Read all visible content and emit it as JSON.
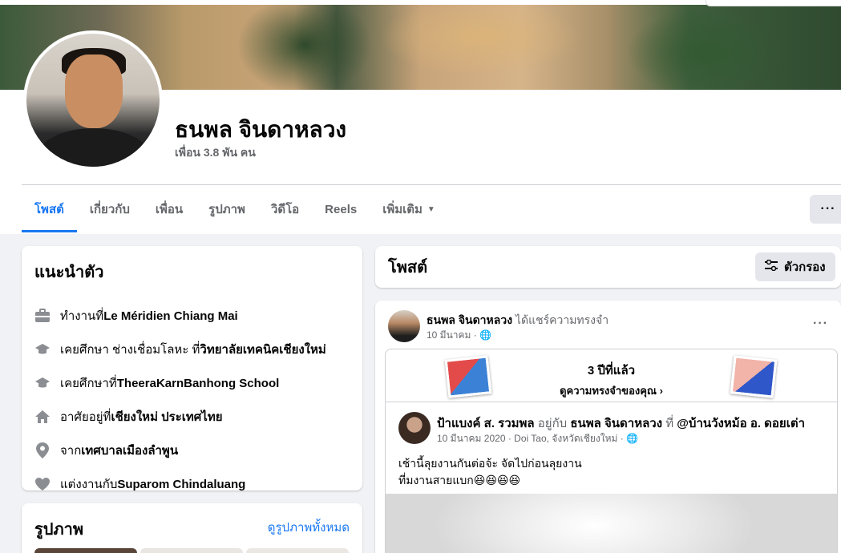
{
  "profile": {
    "name": "ธนพล จินดาหลวง",
    "friends": "เพื่อน 3.8 พัน คน"
  },
  "tabs": [
    {
      "label": "โพสต์"
    },
    {
      "label": "เกี่ยวกับ"
    },
    {
      "label": "เพื่อน"
    },
    {
      "label": "รูปภาพ"
    },
    {
      "label": "วิดีโอ"
    },
    {
      "label": "Reels"
    },
    {
      "label": "เพิ่มเติม"
    }
  ],
  "more_button": "···",
  "intro": {
    "title": "แนะนำตัว",
    "items": [
      {
        "icon": "briefcase-icon",
        "prefix": "ทำงานที่ ",
        "value": "Le Méridien Chiang Mai"
      },
      {
        "icon": "graduation-cap-icon",
        "prefix": "เคยศึกษา ช่างเชื่อมโลหะ ที่ ",
        "value": "วิทยาลัยเทคนิคเชียงใหม่"
      },
      {
        "icon": "graduation-cap-icon",
        "prefix": "เคยศึกษาที่ ",
        "value": "TheeraKarnBanhong School"
      },
      {
        "icon": "home-icon",
        "prefix": "อาศัยอยู่ที่ ",
        "value": "เชียงใหม่ ประเทศไทย"
      },
      {
        "icon": "location-pin-icon",
        "prefix": "จาก ",
        "value": "เทศบาลเมืองลำพูน"
      },
      {
        "icon": "heart-icon",
        "prefix": "แต่งงานกับ ",
        "value": "Suparom Chindaluang"
      }
    ]
  },
  "photos": {
    "title": "รูปภาพ",
    "see_all": "ดูรูปภาพทั้งหมด"
  },
  "posts": {
    "title": "โพสต์",
    "filter_label": "ตัวกรอง"
  },
  "post": {
    "author": "ธนพล จินดาหลวง",
    "action": " ได้แชร์ความทรงจำ",
    "date": "10 มีนาคม · 🌐",
    "menu": "···",
    "memory": {
      "years": "3 ปีที่แล้ว",
      "link": "ดูความทรงจำของคุณ ›"
    },
    "inner": {
      "author": "ป้าแบงค์ ส. รวมพล",
      "with": " อยู่กับ ",
      "tagged": "ธนพล จินดาหลวง",
      "at": " ที่ ",
      "place": "@บ้านวังหม้อ อ. ดอยเต่า",
      "date": "10 มีนาคม 2020 · Doi Tao, จังหวัดเชียงใหม่ · 🌐",
      "text_line1": "เช้านี้ลุยงานกันต่อจ้ะ จัดไปก่อนลุยงาน",
      "text_line2": "ที่มงานสายแบก😆😆😆😆"
    }
  }
}
